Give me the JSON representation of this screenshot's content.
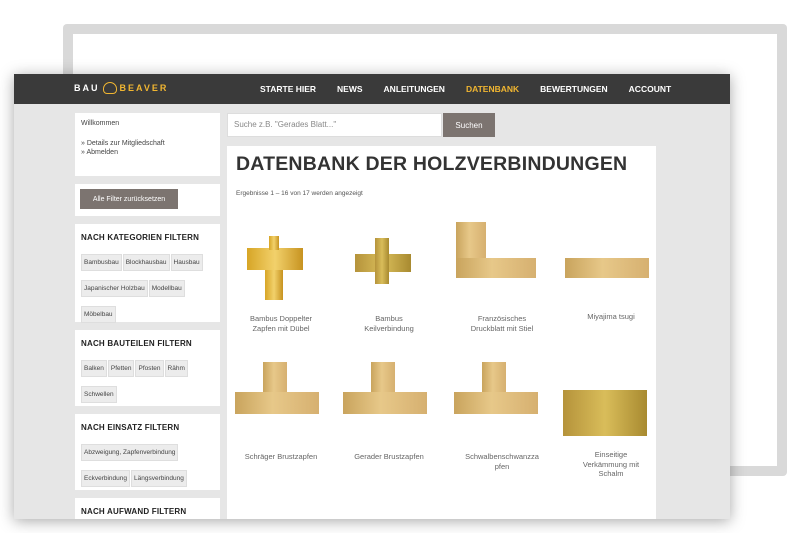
{
  "nav": {
    "logo_left": "BAU",
    "logo_right": "BEAVER",
    "items": [
      {
        "label": "STARTE HIER",
        "active": false
      },
      {
        "label": "NEWS",
        "active": false
      },
      {
        "label": "ANLEITUNGEN",
        "active": false
      },
      {
        "label": "DATENBANK",
        "active": true
      },
      {
        "label": "BEWERTUNGEN",
        "active": false
      },
      {
        "label": "ACCOUNT",
        "active": false
      }
    ]
  },
  "sidebar": {
    "welcome": "Willkommen",
    "member_link": "» Details zur Mitgliedschaft",
    "logout_link": "» Abmelden",
    "reset_label": "Alle Filter zurücksetzen",
    "filters": {
      "categories": {
        "title": "NACH KATEGORIEN FILTERN",
        "chips": [
          "Bambusbau",
          "Blockhausbau",
          "Hausbau",
          "Japanischer Holzbau",
          "Modellbau",
          "Möbelbau"
        ]
      },
      "parts": {
        "title": "NACH BAUTEILEN FILTERN",
        "chips": [
          "Balken",
          "Pfetten",
          "Pfosten",
          "Rähm",
          "Schwellen"
        ]
      },
      "use": {
        "title": "NACH EINSATZ FILTERN",
        "chips": [
          "Abzweigung, Zapfenverbindung",
          "Eckverbindung",
          "Längsverbindung"
        ]
      },
      "effort": {
        "title": "NACH AUFWAND FILTERN"
      }
    }
  },
  "search": {
    "placeholder": "Suche z.B. \"Gerades Blatt...\"",
    "button": "Suchen"
  },
  "main": {
    "title": "DATENBANK DER HOLZVERBINDUNGEN",
    "results": "Ergebnisse 1 – 16 von 17 werden angezeigt",
    "items": [
      {
        "line1": "Bambus Doppelter",
        "line2": "Zapfen mit Dübel",
        "line3": ""
      },
      {
        "line1": "Bambus",
        "line2": "Keilverbindung",
        "line3": ""
      },
      {
        "line1": "Französisches",
        "line2": "Druckblatt mit Stiel",
        "line3": ""
      },
      {
        "line1": "Miyajima tsugi",
        "line2": "",
        "line3": ""
      },
      {
        "line1": "Schräger Brustzapfen",
        "line2": "",
        "line3": ""
      },
      {
        "line1": "Gerader Brustzapfen",
        "line2": "",
        "line3": ""
      },
      {
        "line1": "Schwalbenschwanzza",
        "line2": "pfen",
        "line3": ""
      },
      {
        "line1": "Einseitige",
        "line2": "Verkämmung mit",
        "line3": "Schalm"
      }
    ]
  }
}
